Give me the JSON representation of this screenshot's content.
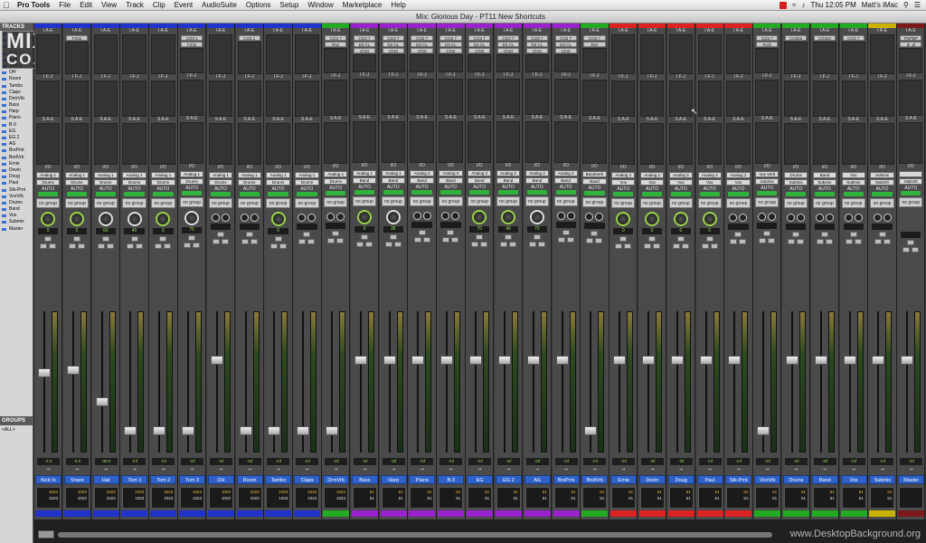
{
  "menubar": {
    "app": "Pro Tools",
    "items": [
      "File",
      "Edit",
      "View",
      "Track",
      "Clip",
      "Event",
      "AudioSuite",
      "Options",
      "Setup",
      "Window",
      "Marketplace",
      "Help"
    ],
    "clock": "Thu 12:05 PM",
    "user": "Matt's iMac"
  },
  "window": {
    "title": "Mix: Glorious Day - PT11 New Shortcuts"
  },
  "sidebar": {
    "tracks_header": "TRACKS",
    "groups_header": "GROUPS",
    "groups_item": "<ALL>"
  },
  "logo": {
    "line1": "MIX",
    "line2": "COACH"
  },
  "watermark": "www.DesktopBackground.org",
  "strips": [
    {
      "name": "Kick In",
      "io": "Analog 1",
      "bus": "Drums",
      "vol": "-4.0",
      "pan": "0",
      "inserts": [],
      "knob": "green",
      "color": "#2233cc",
      "delay": "1023"
    },
    {
      "name": "Snare",
      "io": "Analog 1",
      "bus": "Drums",
      "vol": "-4.0",
      "pan": "0",
      "inserts": [
        "F202"
      ],
      "knob": "green",
      "color": "#2233cc",
      "delay": "1023"
    },
    {
      "name": "Hat",
      "io": "Analog 1",
      "bus": "Drums",
      "vol": "-30.0",
      "pan": "60",
      "inserts": [],
      "knob": "white",
      "color": "#2233cc",
      "delay": "1023"
    },
    {
      "name": "Tom 1",
      "io": "Analog 1",
      "bus": "Drums",
      "vol": "-inf",
      "pan": "40",
      "inserts": [],
      "knob": "white",
      "color": "#2233cc",
      "delay": "1023"
    },
    {
      "name": "Tom 2",
      "io": "Analog 1",
      "bus": "Drums",
      "vol": "-inf",
      "pan": "0",
      "inserts": [],
      "knob": "green",
      "color": "#2233cc",
      "delay": "1023"
    },
    {
      "name": "Tom 3",
      "io": "Analog 1",
      "bus": "Drums",
      "vol": "-inf",
      "pan": "75",
      "inserts": [
        "CQ3 1",
        "F202"
      ],
      "knob": "white",
      "color": "#2233cc",
      "delay": "1023"
    },
    {
      "name": "OH",
      "io": "Analog 1",
      "bus": "Drums",
      "vol": "-inf",
      "pan": "",
      "inserts": [],
      "knob": "pair",
      "color": "#2233cc",
      "delay": "1023"
    },
    {
      "name": "Room",
      "io": "Analog 1",
      "bus": "Drums",
      "vol": "-inf",
      "pan": "",
      "inserts": [
        "CQ3 1"
      ],
      "knob": "pair",
      "color": "#2233cc",
      "delay": "1023"
    },
    {
      "name": "Tambo",
      "io": "Analog 1",
      "bus": "Drums",
      "vol": "-inf",
      "pan": "0",
      "inserts": [],
      "knob": "green",
      "color": "#2233cc",
      "delay": "1023"
    },
    {
      "name": "Claps",
      "io": "Analog 1",
      "bus": "Drums",
      "vol": "-inf",
      "pan": "",
      "inserts": [],
      "knob": "pair",
      "color": "#2233cc",
      "delay": "1023"
    },
    {
      "name": "DrmVrb",
      "io": "Analog 1",
      "bus": "Drums",
      "vol": "-inf",
      "pan": "",
      "inserts": [
        "CQ3 7",
        "Rivr"
      ],
      "knob": "pair",
      "color": "#22aa22",
      "delay": "1023"
    },
    {
      "name": "Bass",
      "io": "Analog 1",
      "bus": "Band",
      "vol": "-inf",
      "pan": "0",
      "inserts": [
        "CQ3 7",
        "D3 CL",
        "ChSt"
      ],
      "knob": "green",
      "color": "#9922cc",
      "delay": "51"
    },
    {
      "name": "Harp",
      "io": "Analog 1",
      "bus": "Band",
      "vol": "-inf",
      "pan": "36",
      "inserts": [
        "CQ3 7",
        "D3 CL",
        "ChSt"
      ],
      "knob": "white",
      "color": "#9922cc",
      "delay": "51"
    },
    {
      "name": "Piano",
      "io": "Analog 2",
      "bus": "Band",
      "vol": "-inf",
      "pan": "",
      "inserts": [
        "CQ3 7",
        "D3 CL",
        "ChSt"
      ],
      "knob": "pair",
      "color": "#9922cc",
      "delay": "51"
    },
    {
      "name": "B-3",
      "io": "Analog 2",
      "bus": "Band",
      "vol": "-inf",
      "pan": "",
      "inserts": [
        "CQ3 7",
        "D3 CL",
        "ChSt"
      ],
      "knob": "pair",
      "color": "#9922cc",
      "delay": "51"
    },
    {
      "name": "EG",
      "io": "Analog 2",
      "bus": "Band",
      "vol": "-inf",
      "pan": "70",
      "inserts": [
        "CQ3 7",
        "D3 CL",
        "ChSt"
      ],
      "knob": "green",
      "color": "#9922cc",
      "delay": "51"
    },
    {
      "name": "EG 2",
      "io": "Analog 2",
      "bus": "Band",
      "vol": "-inf",
      "pan": "40",
      "inserts": [
        "CQ3 7",
        "D3 CL",
        "ChSt"
      ],
      "knob": "green",
      "color": "#9922cc",
      "delay": "51"
    },
    {
      "name": "AG",
      "io": "Analog 2",
      "bus": "Band",
      "vol": "-inf",
      "pan": "70",
      "inserts": [
        "CQ3 7",
        "D3 CL",
        "ChSt"
      ],
      "knob": "white",
      "color": "#9922cc",
      "delay": "51"
    },
    {
      "name": "BrsPrnt",
      "io": "Analog 2",
      "bus": "Band",
      "vol": "-inf",
      "pan": "",
      "inserts": [
        "CQ3 7",
        "D3 CL",
        "ChSt"
      ],
      "knob": "pair",
      "color": "#9922cc",
      "delay": "51"
    },
    {
      "name": "BndVrb",
      "io": "BandVerb",
      "bus": "Band",
      "vol": "-inf",
      "pan": "",
      "inserts": [
        "CQ3 7",
        "Rivr"
      ],
      "knob": "pair",
      "color": "#22aa22",
      "delay": "51"
    },
    {
      "name": "Ernie",
      "io": "Analog 2",
      "bus": "Vox",
      "vol": "-inf",
      "pan": "0",
      "inserts": [],
      "knob": "green",
      "color": "#dd2222",
      "delay": "51"
    },
    {
      "name": "Devin",
      "io": "Analog 2",
      "bus": "Vox",
      "vol": "-inf",
      "pan": "0",
      "inserts": [],
      "knob": "green",
      "color": "#dd2222",
      "delay": "51"
    },
    {
      "name": "Doug",
      "io": "Analog 2",
      "bus": "Vox",
      "vol": "-inf",
      "pan": "0",
      "inserts": [],
      "knob": "green",
      "color": "#dd2222",
      "delay": "51"
    },
    {
      "name": "Paul",
      "io": "Analog 2",
      "bus": "Vox",
      "vol": "-inf",
      "pan": "0",
      "inserts": [],
      "knob": "green",
      "color": "#dd2222",
      "delay": "51"
    },
    {
      "name": "Stk-Prnt",
      "io": "Analog 2",
      "bus": "Vox",
      "vol": "-inf",
      "pan": "",
      "inserts": [],
      "knob": "pair",
      "color": "#dd2222",
      "delay": "51"
    },
    {
      "name": "VoxVrb",
      "io": "Vox Verb",
      "bus": "Submix",
      "vol": "-inf",
      "pan": "",
      "inserts": [
        "CQ3 7",
        "Rvrb"
      ],
      "knob": "pair",
      "color": "#22aa22",
      "delay": "51"
    },
    {
      "name": "Drums",
      "io": "Drums",
      "bus": "Submix",
      "vol": "-inf",
      "pan": "",
      "inserts": [
        "CQ303"
      ],
      "knob": "pair",
      "color": "#22aa22",
      "delay": "51"
    },
    {
      "name": "Band",
      "io": "Band",
      "bus": "Submix",
      "vol": "-inf",
      "pan": "",
      "inserts": [
        "CQ303"
      ],
      "knob": "pair",
      "color": "#22aa22",
      "delay": "51"
    },
    {
      "name": "Vox",
      "io": "Vox",
      "bus": "Submix",
      "vol": "-inf",
      "pan": "",
      "inserts": [
        "CQ3 7"
      ],
      "knob": "pair",
      "color": "#22aa22",
      "delay": "51"
    },
    {
      "name": "Submix",
      "io": "Submix",
      "bus": "MainOt",
      "vol": "-inf",
      "pan": "",
      "inserts": [],
      "knob": "pair",
      "color": "#c8b400",
      "delay": "51"
    },
    {
      "name": "Master",
      "io": "",
      "bus": "MainOt",
      "vol": "-inf",
      "pan": "",
      "inserts": [
        "PSPBP",
        "lk_al"
      ],
      "knob": "none",
      "color": "#7a1a1a",
      "delay": ""
    }
  ],
  "fader_levels": [
    0.56,
    0.58,
    0.34,
    0.12,
    0.12,
    0.12,
    0.66,
    0.12,
    0.12,
    0.12,
    0.12,
    0.66,
    0.66,
    0.66,
    0.66,
    0.66,
    0.66,
    0.66,
    0.66,
    0.12,
    0.66,
    0.66,
    0.66,
    0.66,
    0.66,
    0.12,
    0.66,
    0.66,
    0.66,
    0.66,
    0.66
  ]
}
